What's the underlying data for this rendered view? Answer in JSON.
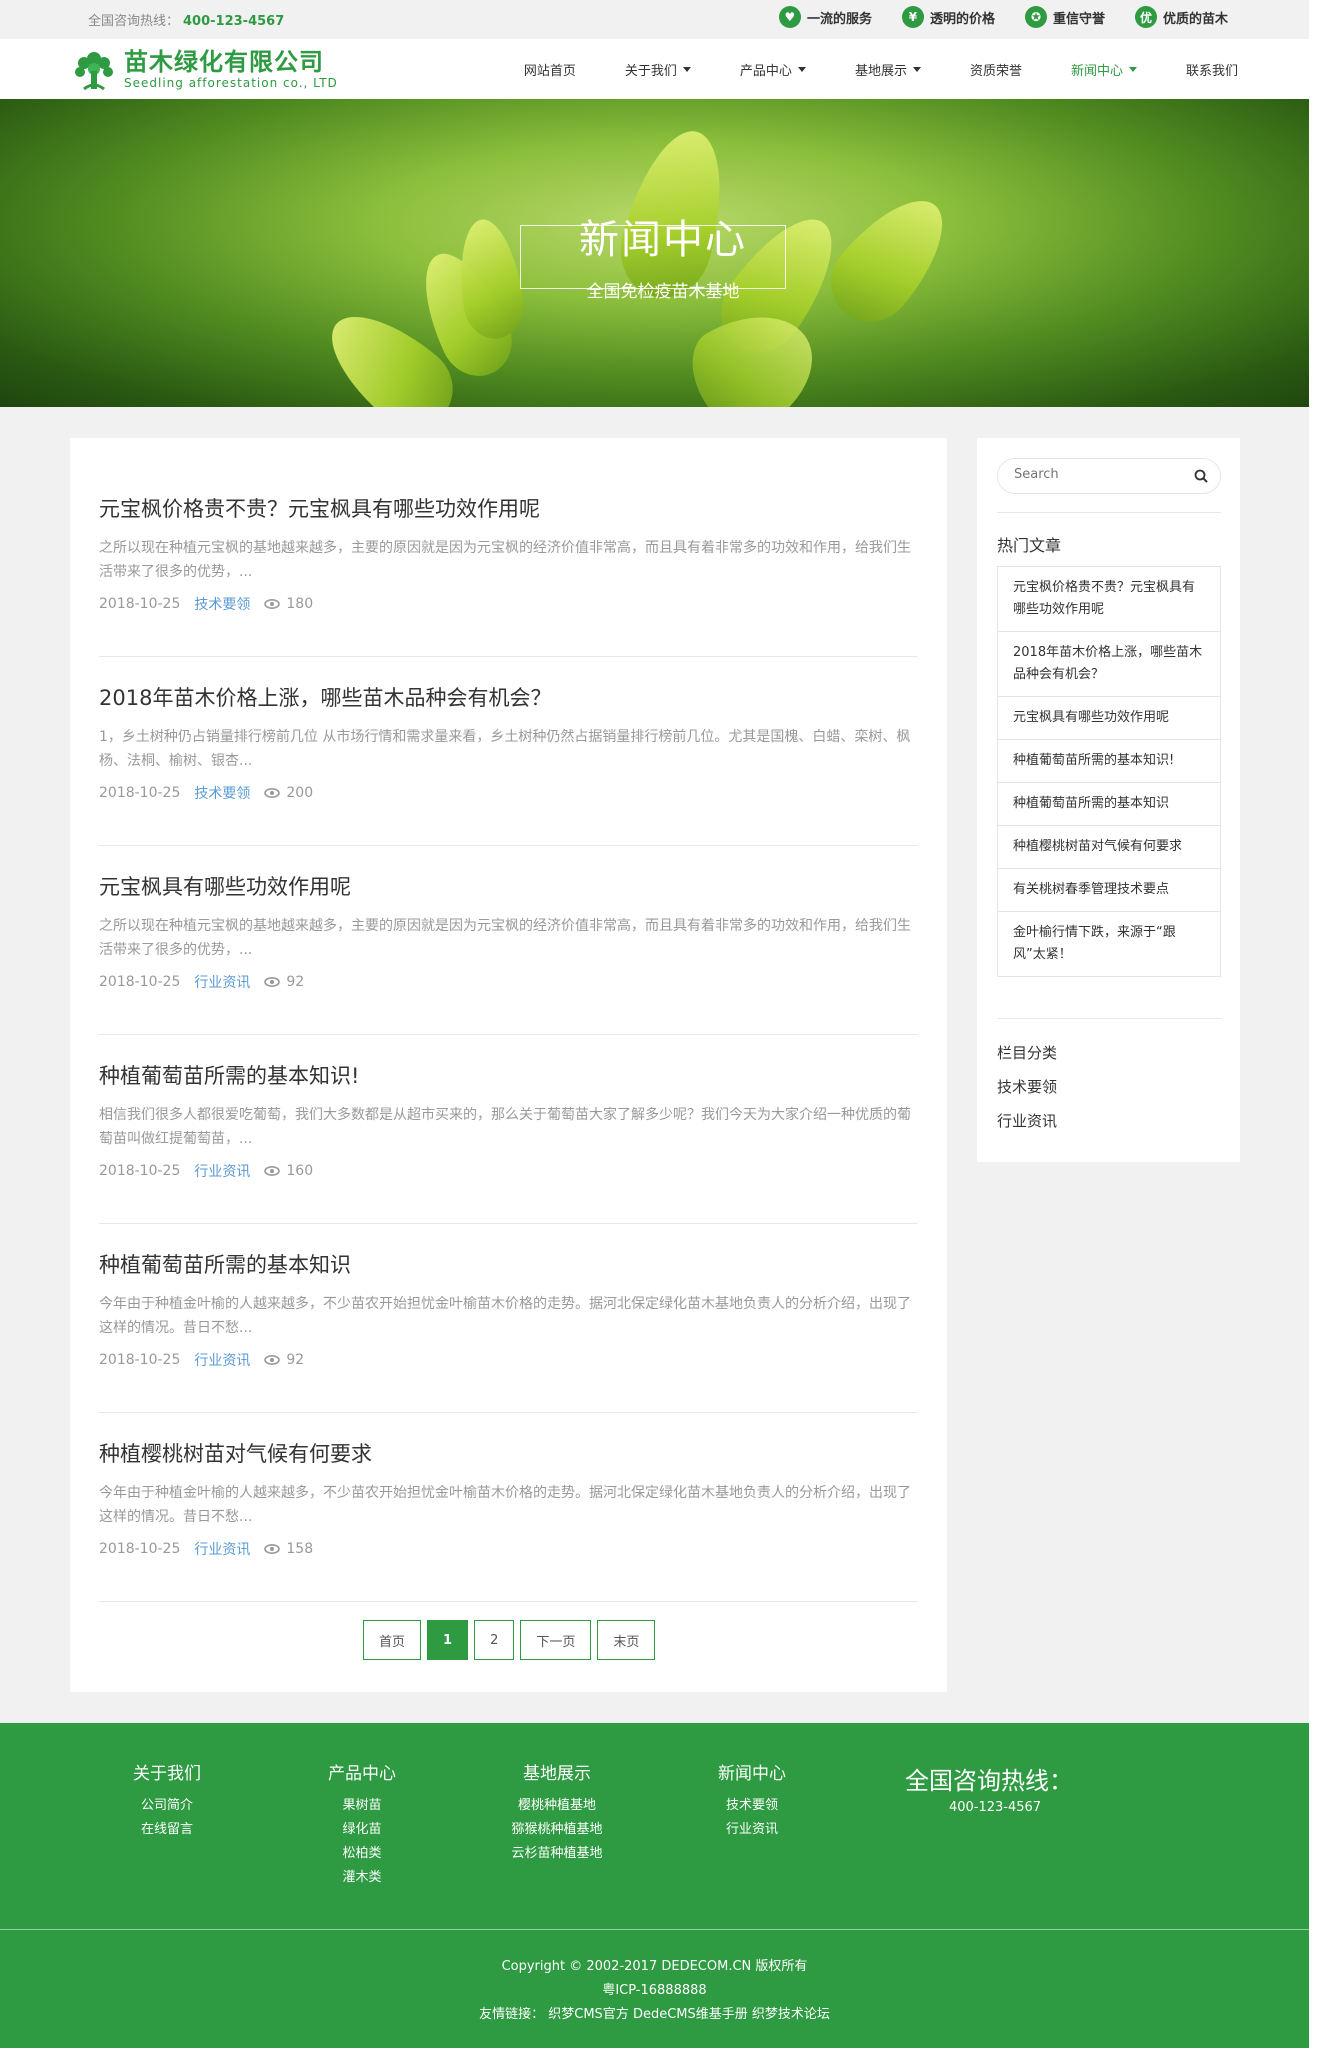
{
  "topbar": {
    "hotline_label": "全国咨询热线：",
    "hotline_number": "400-123-4567",
    "features": [
      {
        "label": "一流的服务",
        "icon": "heart-icon",
        "glyph": "♥"
      },
      {
        "label": "透明的价格",
        "icon": "yen-icon",
        "glyph": "¥"
      },
      {
        "label": "重信守誉",
        "icon": "medal-icon",
        "glyph": "✪"
      },
      {
        "label": "优质的苗木",
        "icon": "quality-badge-icon",
        "glyph": "优"
      }
    ]
  },
  "header": {
    "logo_cn": "苗木绿化有限公司",
    "logo_en": "Seedling afforestation co., LTD",
    "nav": [
      {
        "label": "网站首页",
        "dropdown": false
      },
      {
        "label": "关于我们",
        "dropdown": true
      },
      {
        "label": "产品中心",
        "dropdown": true
      },
      {
        "label": "基地展示",
        "dropdown": true
      },
      {
        "label": "资质荣誉",
        "dropdown": false
      },
      {
        "label": "新闻中心",
        "dropdown": true,
        "active": true
      },
      {
        "label": "联系我们",
        "dropdown": false
      }
    ]
  },
  "banner": {
    "title": "新闻中心",
    "subtitle": "全国免检疫苗木基地"
  },
  "articles": [
    {
      "title": "元宝枫价格贵不贵？元宝枫具有哪些功效作用呢",
      "desc": "之所以现在种植元宝枫的基地越来越多，主要的原因就是因为元宝枫的经济价值非常高，而且具有着非常多的功效和作用，给我们生活带来了很多的优势，...",
      "date": "2018-10-25",
      "category": "技术要领",
      "views": "180"
    },
    {
      "title": "2018年苗木价格上涨，哪些苗木品种会有机会？",
      "desc": "1，乡土树种仍占销量排行榜前几位 从市场行情和需求量来看，乡土树种仍然占据销量排行榜前几位。尤其是国槐、白蜡、栾树、枫杨、法桐、榆树、银杏...",
      "date": "2018-10-25",
      "category": "技术要领",
      "views": "200"
    },
    {
      "title": "元宝枫具有哪些功效作用呢",
      "desc": "之所以现在种植元宝枫的基地越来越多，主要的原因就是因为元宝枫的经济价值非常高，而且具有着非常多的功效和作用，给我们生活带来了很多的优势，...",
      "date": "2018-10-25",
      "category": "行业资讯",
      "views": "92"
    },
    {
      "title": "种植葡萄苗所需的基本知识!",
      "desc": "相信我们很多人都很爱吃葡萄，我们大多数都是从超市买来的，那么关于葡萄苗大家了解多少呢？我们今天为大家介绍一种优质的葡萄苗叫做红提葡萄苗，...",
      "date": "2018-10-25",
      "category": "行业资讯",
      "views": "160"
    },
    {
      "title": "种植葡萄苗所需的基本知识",
      "desc": "今年由于种植金叶榆的人越来越多，不少苗农开始担忧金叶榆苗木价格的走势。据河北保定绿化苗木基地负责人的分析介绍，出现了这样的情况。昔日不愁...",
      "date": "2018-10-25",
      "category": "行业资讯",
      "views": "92"
    },
    {
      "title": "种植樱桃树苗对气候有何要求",
      "desc": "今年由于种植金叶榆的人越来越多，不少苗农开始担忧金叶榆苗木价格的走势。据河北保定绿化苗木基地负责人的分析介绍，出现了这样的情况。昔日不愁...",
      "date": "2018-10-25",
      "category": "行业资讯",
      "views": "158"
    }
  ],
  "pager": {
    "first": "首页",
    "pages": [
      "1",
      "2"
    ],
    "current": "1",
    "next": "下一页",
    "last": "末页"
  },
  "sidebar": {
    "search_placeholder": "Search",
    "hot_title": "热门文章",
    "hot": [
      "元宝枫价格贵不贵？元宝枫具有哪些功效作用呢",
      "2018年苗木价格上涨，哪些苗木品种会有机会？",
      "元宝枫具有哪些功效作用呢",
      "种植葡萄苗所需的基本知识!",
      "种植葡萄苗所需的基本知识",
      "种植樱桃树苗对气候有何要求",
      "有关桃树春季管理技术要点",
      "金叶榆行情下跌，来源于“跟风”太紧！"
    ],
    "cat_title": "栏目分类",
    "cats": [
      "技术要领",
      "行业资讯"
    ]
  },
  "footer": {
    "columns": [
      {
        "title": "关于我们",
        "links": [
          "公司简介",
          "在线留言"
        ]
      },
      {
        "title": "产品中心",
        "links": [
          "果树苗",
          "绿化苗",
          "松柏类",
          "灌木类"
        ]
      },
      {
        "title": "基地展示",
        "links": [
          "樱桃种植基地",
          "猕猴桃种植基地",
          "云杉苗种植基地"
        ]
      },
      {
        "title": "新闻中心",
        "links": [
          "技术要领",
          "行业资讯"
        ]
      }
    ],
    "hotline_title": "全国咨询热线：",
    "hotline_number": "400-123-4567",
    "copyright": "Copyright © 2002-2017 DEDECOM.CN 版权所有",
    "icp": "粤ICP-16888888",
    "friend_label": "友情链接：",
    "friend_links": [
      "织梦CMS官方",
      "DedeCMS维基手册",
      "织梦技术论坛"
    ]
  },
  "colors": {
    "brand": "#2e9a41",
    "link": "#5a9bd5"
  }
}
